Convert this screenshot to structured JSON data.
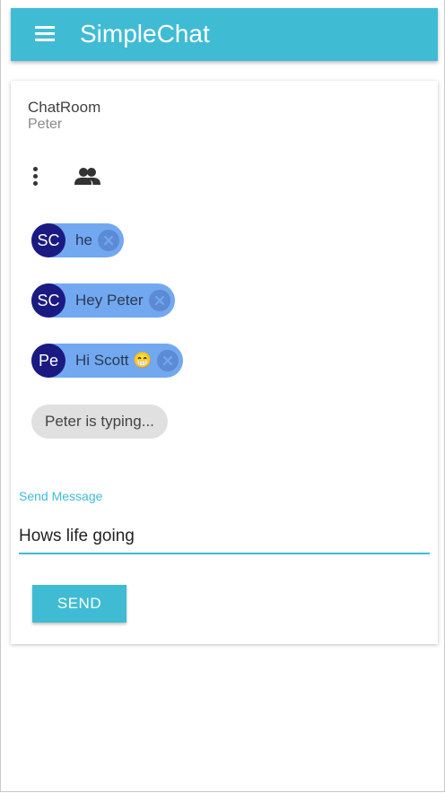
{
  "app": {
    "title": "SimpleChat",
    "menu_icon": "hamburger-menu-icon"
  },
  "room": {
    "title": "ChatRoom",
    "user": "Peter"
  },
  "actions": {
    "more_icon": "more-vert-icon",
    "people_icon": "people-icon"
  },
  "messages": [
    {
      "initials": "SC",
      "text": "he"
    },
    {
      "initials": "SC",
      "text": "Hey Peter"
    },
    {
      "initials": "Pe",
      "text": "Hi Scott 😁"
    }
  ],
  "typing_indicator": "Peter is typing...",
  "composer": {
    "label": "Send Message",
    "value": "Hows life going",
    "send_label": "SEND"
  },
  "colors": {
    "accent": "#3fbcd4",
    "chip": "#72a8f0",
    "avatar": "#1a1a82",
    "typing_chip": "#e0e0e0"
  }
}
